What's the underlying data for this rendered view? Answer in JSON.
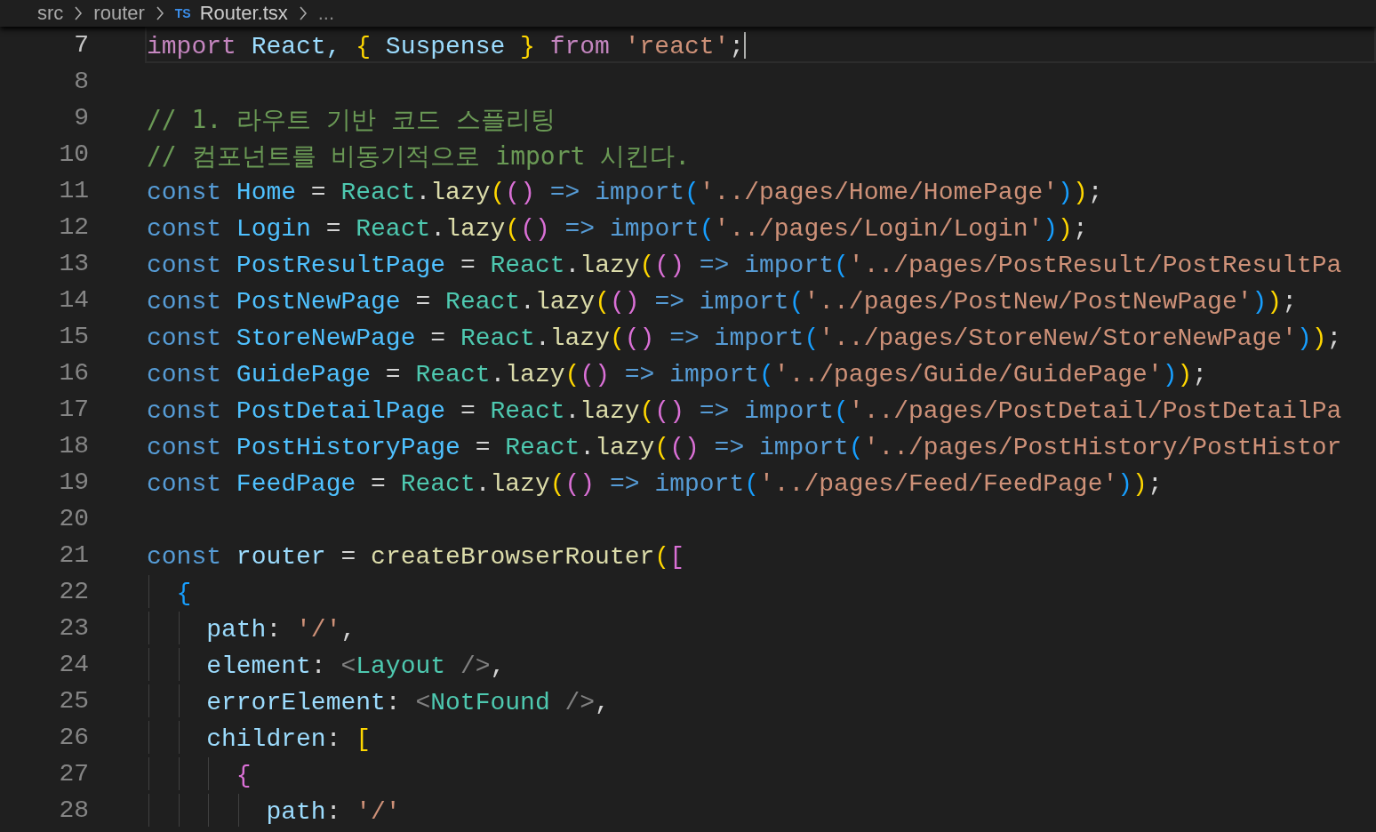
{
  "breadcrumbs": [
    {
      "label": "src",
      "kind": "folder"
    },
    {
      "label": "router",
      "kind": "folder"
    },
    {
      "label": "Router.tsx",
      "kind": "file",
      "badge": "TS"
    },
    {
      "label": "...",
      "kind": "more"
    }
  ],
  "lines": [
    {
      "number": "7",
      "active": true,
      "tokens": [
        {
          "text": "import ",
          "kind": "i"
        },
        {
          "text": "React, ",
          "kind": "r"
        },
        {
          "text": "{ ",
          "kind": "b1"
        },
        {
          "text": "Suspense ",
          "kind": "r"
        },
        {
          "text": "} ",
          "kind": "b1"
        },
        {
          "text": "from ",
          "kind": "i"
        },
        {
          "text": "'react'",
          "kind": "s"
        },
        {
          "text": ";",
          "kind": "p"
        }
      ]
    },
    {
      "number": "8",
      "active": false
    },
    {
      "number": "9",
      "active": false,
      "tokens": [
        {
          "text": "// 1. 라우트 기반 코드 스플리팅",
          "kind": "m"
        }
      ]
    },
    {
      "number": "10",
      "active": false,
      "tokens": [
        {
          "text": "// 컴포넌트를 비동기적으로 import 시킨다.",
          "kind": "m"
        }
      ]
    },
    {
      "number": "11",
      "active": false,
      "tokens": [
        {
          "text": "const ",
          "kind": "k"
        },
        {
          "text": "Home",
          "kind": "v"
        },
        {
          "text": " = ",
          "kind": "p"
        },
        {
          "text": "React",
          "kind": "c"
        },
        {
          "text": ".",
          "kind": "p"
        },
        {
          "text": "lazy",
          "kind": "f"
        },
        {
          "text": "(",
          "kind": "b1"
        },
        {
          "text": "() ",
          "kind": "b2"
        },
        {
          "text": "=> ",
          "kind": "k"
        },
        {
          "text": "import",
          "kind": "k"
        },
        {
          "text": "(",
          "kind": "b3"
        },
        {
          "text": "'../pages/Home/HomePage'",
          "kind": "s"
        },
        {
          "text": ")",
          "kind": "b3"
        },
        {
          "text": ")",
          "kind": "b1"
        },
        {
          "text": ";",
          "kind": "p"
        }
      ]
    },
    {
      "number": "12",
      "active": false,
      "tokens": [
        {
          "text": "const ",
          "kind": "k"
        },
        {
          "text": "Login",
          "kind": "v"
        },
        {
          "text": " = ",
          "kind": "p"
        },
        {
          "text": "React",
          "kind": "c"
        },
        {
          "text": ".",
          "kind": "p"
        },
        {
          "text": "lazy",
          "kind": "f"
        },
        {
          "text": "(",
          "kind": "b1"
        },
        {
          "text": "() ",
          "kind": "b2"
        },
        {
          "text": "=> ",
          "kind": "k"
        },
        {
          "text": "import",
          "kind": "k"
        },
        {
          "text": "(",
          "kind": "b3"
        },
        {
          "text": "'../pages/Login/Login'",
          "kind": "s"
        },
        {
          "text": ")",
          "kind": "b3"
        },
        {
          "text": ")",
          "kind": "b1"
        },
        {
          "text": ";",
          "kind": "p"
        }
      ]
    },
    {
      "number": "13",
      "active": false,
      "tokens": [
        {
          "text": "const ",
          "kind": "k"
        },
        {
          "text": "PostResultPage",
          "kind": "v"
        },
        {
          "text": " = ",
          "kind": "p"
        },
        {
          "text": "React",
          "kind": "c"
        },
        {
          "text": ".",
          "kind": "p"
        },
        {
          "text": "lazy",
          "kind": "f"
        },
        {
          "text": "(",
          "kind": "b1"
        },
        {
          "text": "() ",
          "kind": "b2"
        },
        {
          "text": "=> ",
          "kind": "k"
        },
        {
          "text": "import",
          "kind": "k"
        },
        {
          "text": "(",
          "kind": "b3"
        },
        {
          "text": "'../pages/PostResult/PostResultPa",
          "kind": "s"
        }
      ]
    },
    {
      "number": "14",
      "active": false,
      "tokens": [
        {
          "text": "const ",
          "kind": "k"
        },
        {
          "text": "PostNewPage",
          "kind": "v"
        },
        {
          "text": " = ",
          "kind": "p"
        },
        {
          "text": "React",
          "kind": "c"
        },
        {
          "text": ".",
          "kind": "p"
        },
        {
          "text": "lazy",
          "kind": "f"
        },
        {
          "text": "(",
          "kind": "b1"
        },
        {
          "text": "() ",
          "kind": "b2"
        },
        {
          "text": "=> ",
          "kind": "k"
        },
        {
          "text": "import",
          "kind": "k"
        },
        {
          "text": "(",
          "kind": "b3"
        },
        {
          "text": "'../pages/PostNew/PostNewPage'",
          "kind": "s"
        },
        {
          "text": ")",
          "kind": "b3"
        },
        {
          "text": ")",
          "kind": "b1"
        },
        {
          "text": ";",
          "kind": "p"
        }
      ]
    },
    {
      "number": "15",
      "active": false,
      "tokens": [
        {
          "text": "const ",
          "kind": "k"
        },
        {
          "text": "StoreNewPage",
          "kind": "v"
        },
        {
          "text": " = ",
          "kind": "p"
        },
        {
          "text": "React",
          "kind": "c"
        },
        {
          "text": ".",
          "kind": "p"
        },
        {
          "text": "lazy",
          "kind": "f"
        },
        {
          "text": "(",
          "kind": "b1"
        },
        {
          "text": "() ",
          "kind": "b2"
        },
        {
          "text": "=> ",
          "kind": "k"
        },
        {
          "text": "import",
          "kind": "k"
        },
        {
          "text": "(",
          "kind": "b3"
        },
        {
          "text": "'../pages/StoreNew/StoreNewPage'",
          "kind": "s"
        },
        {
          "text": ")",
          "kind": "b3"
        },
        {
          "text": ")",
          "kind": "b1"
        },
        {
          "text": ";",
          "kind": "p"
        }
      ]
    },
    {
      "number": "16",
      "active": false,
      "tokens": [
        {
          "text": "const ",
          "kind": "k"
        },
        {
          "text": "GuidePage",
          "kind": "v"
        },
        {
          "text": " = ",
          "kind": "p"
        },
        {
          "text": "React",
          "kind": "c"
        },
        {
          "text": ".",
          "kind": "p"
        },
        {
          "text": "lazy",
          "kind": "f"
        },
        {
          "text": "(",
          "kind": "b1"
        },
        {
          "text": "() ",
          "kind": "b2"
        },
        {
          "text": "=> ",
          "kind": "k"
        },
        {
          "text": "import",
          "kind": "k"
        },
        {
          "text": "(",
          "kind": "b3"
        },
        {
          "text": "'../pages/Guide/GuidePage'",
          "kind": "s"
        },
        {
          "text": ")",
          "kind": "b3"
        },
        {
          "text": ")",
          "kind": "b1"
        },
        {
          "text": ";",
          "kind": "p"
        }
      ]
    },
    {
      "number": "17",
      "active": false,
      "tokens": [
        {
          "text": "const ",
          "kind": "k"
        },
        {
          "text": "PostDetailPage",
          "kind": "v"
        },
        {
          "text": " = ",
          "kind": "p"
        },
        {
          "text": "React",
          "kind": "c"
        },
        {
          "text": ".",
          "kind": "p"
        },
        {
          "text": "lazy",
          "kind": "f"
        },
        {
          "text": "(",
          "kind": "b1"
        },
        {
          "text": "() ",
          "kind": "b2"
        },
        {
          "text": "=> ",
          "kind": "k"
        },
        {
          "text": "import",
          "kind": "k"
        },
        {
          "text": "(",
          "kind": "b3"
        },
        {
          "text": "'../pages/PostDetail/PostDetailPa",
          "kind": "s"
        }
      ]
    },
    {
      "number": "18",
      "active": false,
      "tokens": [
        {
          "text": "const ",
          "kind": "k"
        },
        {
          "text": "PostHistoryPage",
          "kind": "v"
        },
        {
          "text": " = ",
          "kind": "p"
        },
        {
          "text": "React",
          "kind": "c"
        },
        {
          "text": ".",
          "kind": "p"
        },
        {
          "text": "lazy",
          "kind": "f"
        },
        {
          "text": "(",
          "kind": "b1"
        },
        {
          "text": "() ",
          "kind": "b2"
        },
        {
          "text": "=> ",
          "kind": "k"
        },
        {
          "text": "import",
          "kind": "k"
        },
        {
          "text": "(",
          "kind": "b3"
        },
        {
          "text": "'../pages/PostHistory/PostHistor",
          "kind": "s"
        }
      ]
    },
    {
      "number": "19",
      "active": false,
      "tokens": [
        {
          "text": "const ",
          "kind": "k"
        },
        {
          "text": "FeedPage",
          "kind": "v"
        },
        {
          "text": " = ",
          "kind": "p"
        },
        {
          "text": "React",
          "kind": "c"
        },
        {
          "text": ".",
          "kind": "p"
        },
        {
          "text": "lazy",
          "kind": "f"
        },
        {
          "text": "(",
          "kind": "b1"
        },
        {
          "text": "() ",
          "kind": "b2"
        },
        {
          "text": "=> ",
          "kind": "k"
        },
        {
          "text": "import",
          "kind": "k"
        },
        {
          "text": "(",
          "kind": "b3"
        },
        {
          "text": "'../pages/Feed/FeedPage'",
          "kind": "s"
        },
        {
          "text": ")",
          "kind": "b3"
        },
        {
          "text": ")",
          "kind": "b1"
        },
        {
          "text": ";",
          "kind": "p"
        }
      ]
    },
    {
      "number": "20",
      "active": false
    },
    {
      "number": "21",
      "active": false,
      "tokens": [
        {
          "text": "const ",
          "kind": "k"
        },
        {
          "text": "router",
          "kind": "r"
        },
        {
          "text": " = ",
          "kind": "p"
        },
        {
          "text": "createBrowserRouter",
          "kind": "f"
        },
        {
          "text": "(",
          "kind": "b1"
        },
        {
          "text": "[",
          "kind": "b2"
        }
      ]
    },
    {
      "number": "22",
      "active": false,
      "tokens": [
        {
          "text": "  {",
          "kind": "b3"
        }
      ]
    },
    {
      "number": "23",
      "active": false,
      "tokens": [
        {
          "text": "    path",
          "kind": "r"
        },
        {
          "text": ": ",
          "kind": "p"
        },
        {
          "text": "'/'",
          "kind": "s"
        },
        {
          "text": ",",
          "kind": "p"
        }
      ]
    },
    {
      "number": "24",
      "active": false,
      "tokens": [
        {
          "text": "    element",
          "kind": "r"
        },
        {
          "text": ": ",
          "kind": "p"
        },
        {
          "text": "<",
          "kind": "g"
        },
        {
          "text": "Layout",
          "kind": "t"
        },
        {
          "text": " />",
          "kind": "g"
        },
        {
          "text": ",",
          "kind": "p"
        }
      ]
    },
    {
      "number": "25",
      "active": false,
      "tokens": [
        {
          "text": "    errorElement",
          "kind": "r"
        },
        {
          "text": ": ",
          "kind": "p"
        },
        {
          "text": "<",
          "kind": "g"
        },
        {
          "text": "NotFound",
          "kind": "t"
        },
        {
          "text": " />",
          "kind": "g"
        },
        {
          "text": ",",
          "kind": "p"
        }
      ]
    },
    {
      "number": "26",
      "active": false,
      "tokens": [
        {
          "text": "    children",
          "kind": "r"
        },
        {
          "text": ": ",
          "kind": "p"
        },
        {
          "text": "[",
          "kind": "b1"
        }
      ]
    },
    {
      "number": "27",
      "active": false,
      "tokens": [
        {
          "text": "      {",
          "kind": "b2"
        }
      ]
    },
    {
      "number": "28",
      "active": false,
      "tokens": [
        {
          "text": "        path",
          "kind": "r"
        },
        {
          "text": ": ",
          "kind": "p"
        },
        {
          "text": "'/'",
          "kind": "s"
        }
      ]
    }
  ]
}
